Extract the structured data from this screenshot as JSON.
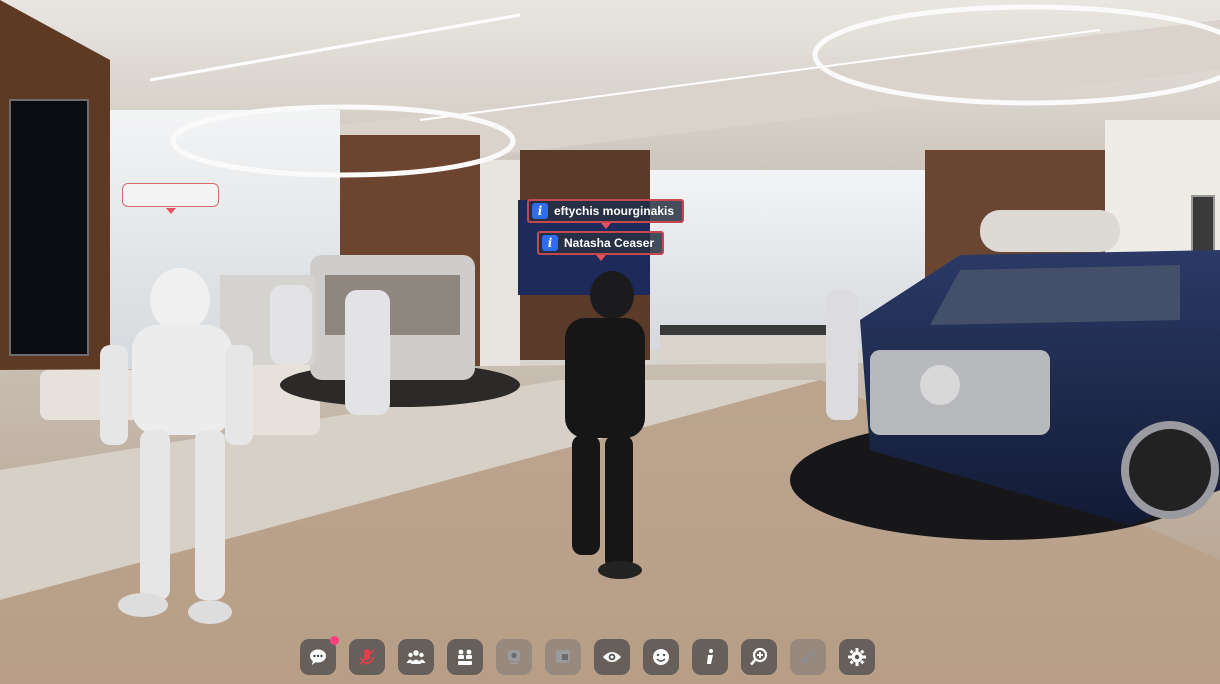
{
  "name_tags": [
    {
      "label": "eftychis mourginakis",
      "icon": "info-icon"
    },
    {
      "label": "Natasha Ceaser",
      "icon": "info-icon"
    }
  ],
  "toolbar": [
    {
      "name": "chat-button",
      "icon": "chat-bubble-icon",
      "notification": true,
      "state": "active"
    },
    {
      "name": "microphone-button",
      "icon": "microphone-muted-icon",
      "notification": false,
      "state": "muted"
    },
    {
      "name": "participants-button",
      "icon": "people-group-icon",
      "notification": false,
      "state": "active"
    },
    {
      "name": "breakout-button",
      "icon": "people-swap-icon",
      "notification": false,
      "state": "active"
    },
    {
      "name": "camera-button",
      "icon": "webcam-icon",
      "notification": false,
      "state": "disabled"
    },
    {
      "name": "screen-share-button",
      "icon": "screen-share-icon",
      "notification": false,
      "state": "disabled"
    },
    {
      "name": "view-button",
      "icon": "eye-icon",
      "notification": false,
      "state": "active"
    },
    {
      "name": "emote-button",
      "icon": "smiley-icon",
      "notification": false,
      "state": "active"
    },
    {
      "name": "info-button",
      "icon": "info-icon",
      "notification": false,
      "state": "active"
    },
    {
      "name": "zoom-button",
      "icon": "zoom-in-icon",
      "notification": false,
      "state": "active"
    },
    {
      "name": "move-button",
      "icon": "move-arrows-icon",
      "notification": false,
      "state": "disabled"
    },
    {
      "name": "settings-button",
      "icon": "gear-icon",
      "notification": false,
      "state": "active"
    }
  ],
  "colors": {
    "tag_border": "#c4484f",
    "info_blue": "#2f6cf0",
    "notification": "#ff3f7d",
    "muted_red": "#e0404a"
  }
}
